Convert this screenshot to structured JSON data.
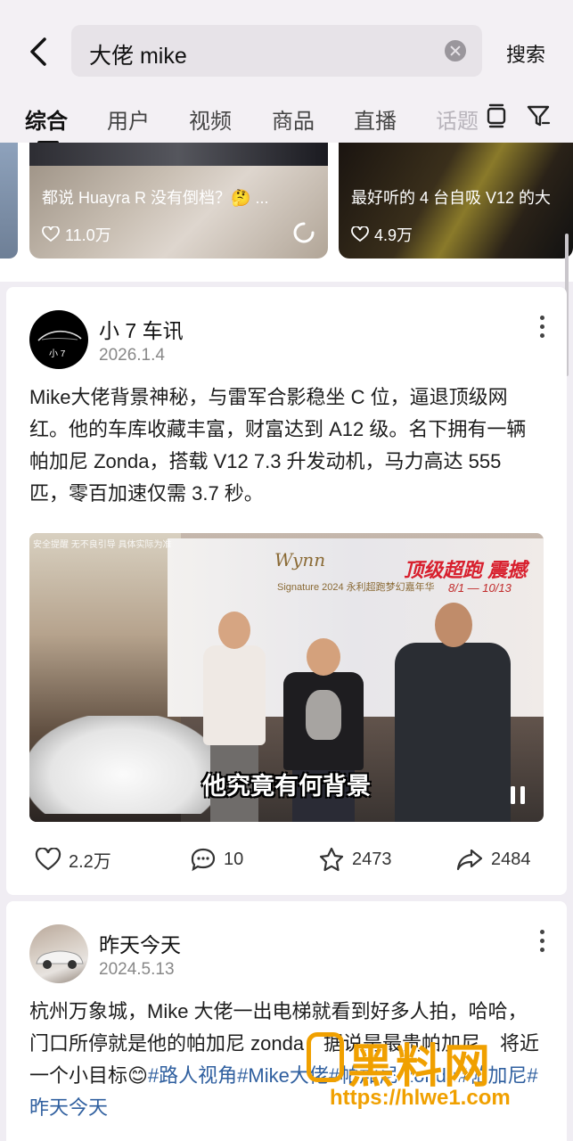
{
  "header": {
    "search_value": "大佬 mike",
    "search_button": "搜索"
  },
  "tabs": [
    {
      "label": "综合",
      "active": true
    },
    {
      "label": "用户"
    },
    {
      "label": "视频"
    },
    {
      "label": "商品"
    },
    {
      "label": "直播"
    },
    {
      "label": "话题"
    }
  ],
  "video_strip": [
    {
      "title": "都说 Huayra R 没有倒档？🤔 ...",
      "likes": "11.0万"
    },
    {
      "title": "最好听的 4 台自吸 V12 的大",
      "likes": "4.9万"
    }
  ],
  "posts": [
    {
      "author": "小 7 车讯",
      "avatar_text": "小 7",
      "date": "2026.1.4",
      "text": "Mike大佬背景神秘，与雷军合影稳坐 C 位，逼退顶级网红。他的车库收藏丰富，财富达到 A12 级。名下拥有一辆帕加尼 Zonda，搭载 V12 7.3 升发动机，马力高达 555 匹，零百加速仅需 3.7 秒。",
      "video": {
        "caption": "他究竟有何背景",
        "top_note": "安全提醒 无不良引导 具体实际为准",
        "brand": "Wynn",
        "brand_sub": "Signature",
        "event": "2024 永利超跑梦幻嘉年华",
        "headline": "顶级超跑 震撼",
        "dates": "8/1 — 10/13"
      },
      "likes": "2.2万",
      "comments": "10",
      "favorites": "2473",
      "shares": "2484"
    },
    {
      "author": "昨天今天",
      "date": "2024.5.13",
      "text_plain": "杭州万象城，Mike 大佬一出电梯就看到好多人拍，哈哈，门口所停就是他的帕加尼 zonda，据说是最贵帕加尼，将近一个小目标😊",
      "tags": "#路人视角#Mike大佬#帕加尼 zonda#帕加尼#昨天今天"
    }
  ],
  "watermark": {
    "text": "黑料网",
    "url": "https://hlwe1.com"
  },
  "colors": {
    "tag": "#2f5f9f",
    "watermark": "#f0a000",
    "headline": "#d8202e"
  }
}
